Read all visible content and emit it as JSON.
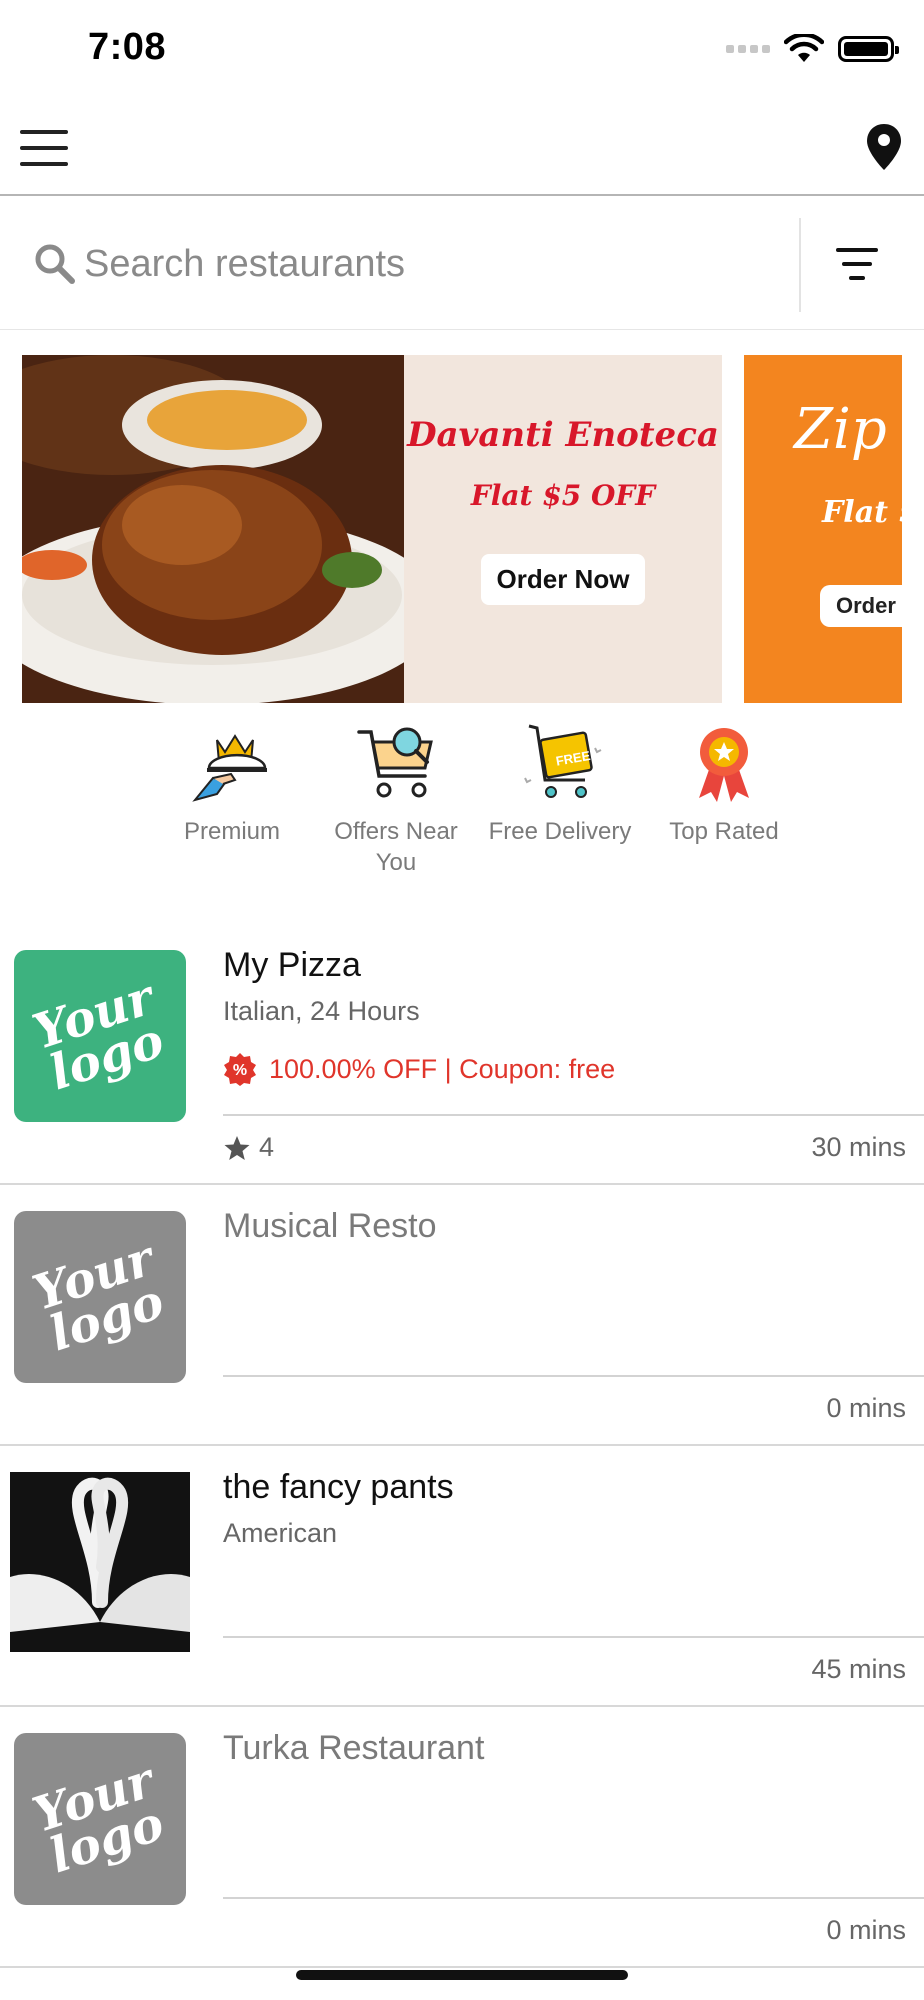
{
  "status_bar": {
    "time": "7:08"
  },
  "search": {
    "placeholder": "Search restaurants"
  },
  "banners": [
    {
      "title": "Davanti Enoteca",
      "offer": "Flat $5 OFF",
      "cta": "Order Now",
      "bg_color": "#f2e6dd",
      "text_color": "#d8172a"
    },
    {
      "title": "Zip",
      "offer": "Flat $",
      "cta": "Order",
      "bg_color": "#f3851f",
      "text_color": "#ffffff"
    }
  ],
  "categories": [
    {
      "label": "Premium",
      "icon": "crown-tray-icon"
    },
    {
      "label": "Offers Near You",
      "icon": "shopping-cart-search-icon"
    },
    {
      "label": "Free Delivery",
      "icon": "free-delivery-cart-icon"
    },
    {
      "label": "Top Rated",
      "icon": "award-ribbon-icon"
    }
  ],
  "restaurants": [
    {
      "name": "My Pizza",
      "cuisine": "Italian, 24 Hours",
      "offer": "100.00% OFF | Coupon: free",
      "rating": "4",
      "time": "30 mins",
      "logo_text": "Your logo",
      "logo_color": "#3db27f",
      "open": true
    },
    {
      "name": "Musical Resto",
      "cuisine": "",
      "offer": "",
      "rating": "",
      "time": "0 mins",
      "logo_text": "Your logo",
      "logo_color": "#8c8c8c",
      "open": false
    },
    {
      "name": "the fancy pants",
      "cuisine": "American",
      "offer": "",
      "rating": "",
      "time": "45 mins",
      "logo_text": "",
      "logo_color": "#111111",
      "open": true
    },
    {
      "name": "Turka Restaurant",
      "cuisine": "",
      "offer": "",
      "rating": "",
      "time": "0 mins",
      "logo_text": "Your logo",
      "logo_color": "#8c8c8c",
      "open": false
    }
  ],
  "colors": {
    "accent_offer": "#e0352b",
    "divider": "#d3d3d3"
  }
}
